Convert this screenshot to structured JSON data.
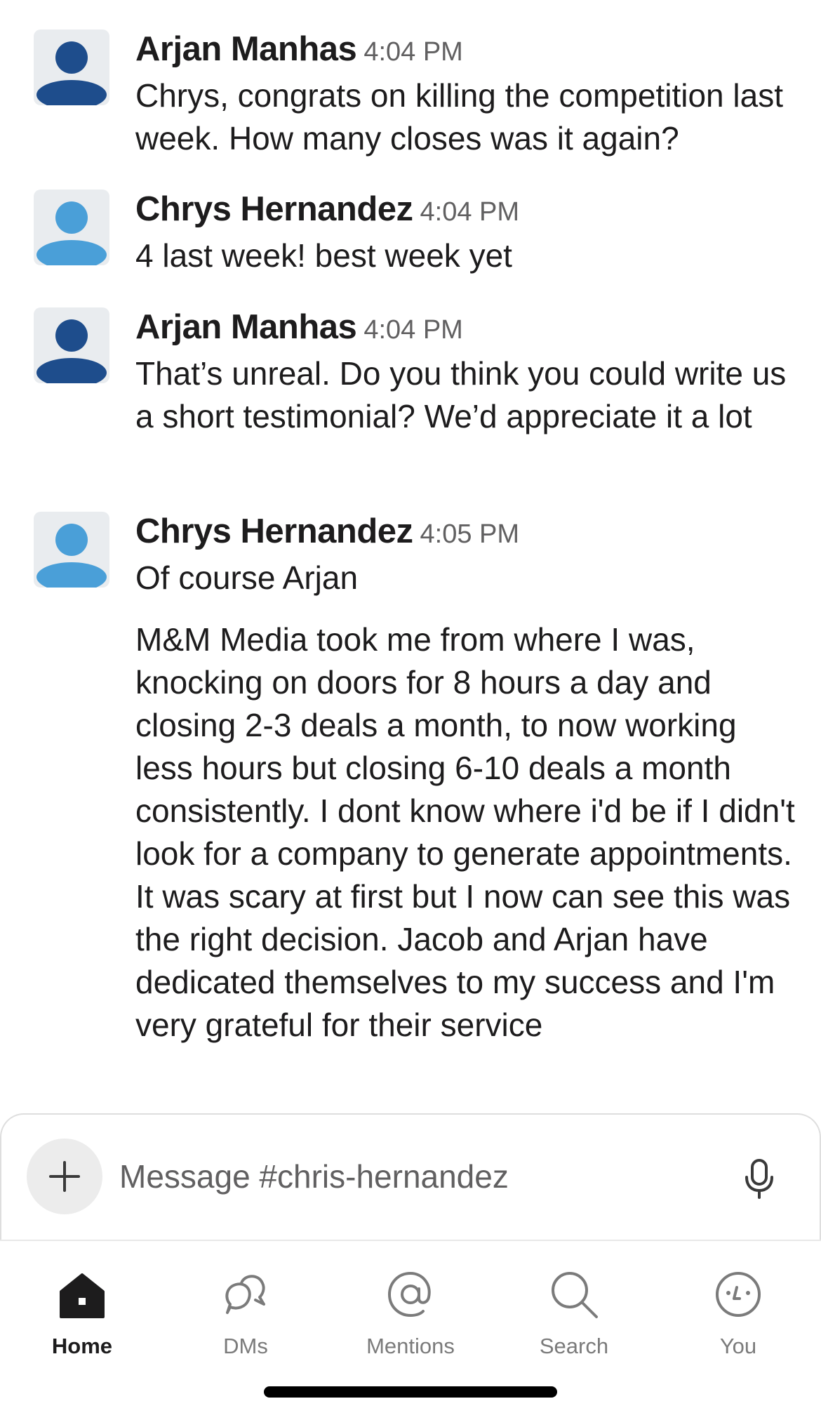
{
  "messages": [
    {
      "sender": "Arjan Manhas",
      "time": "4:04 PM",
      "avatar_color": "#1e4d8c",
      "paragraphs": [
        "Chrys, congrats on killing the competition last week. How many closes was it again?"
      ]
    },
    {
      "sender": "Chrys Hernandez",
      "time": "4:04 PM",
      "avatar_color": "#4a9fd8",
      "paragraphs": [
        "4 last week! best week yet"
      ]
    },
    {
      "sender": "Arjan Manhas",
      "time": "4:04 PM",
      "avatar_color": "#1e4d8c",
      "paragraphs": [
        "That’s unreal. Do you think you could write us a short testimonial? We’d appreciate it a lot"
      ]
    },
    {
      "sender": "Chrys Hernandez",
      "time": "4:05 PM",
      "avatar_color": "#4a9fd8",
      "paragraphs": [
        "Of course Arjan",
        "M&M Media took me from where I was, knocking on doors for 8 hours a day and closing 2-3 deals a month, to now working less hours but closing 6-10 deals a month consistently. I dont know where i'd be if I didn't look for a company to generate appointments. It was scary at first but I now can see this was the right decision. Jacob and Arjan have dedicated themselves to my success and I'm very grateful for their service"
      ]
    }
  ],
  "composer": {
    "placeholder": "Message #chris-hernandez",
    "value": "",
    "add_icon": "plus-icon",
    "mic_icon": "microphone-icon"
  },
  "tabs": [
    {
      "label": "Home",
      "icon": "home-icon",
      "active": true
    },
    {
      "label": "DMs",
      "icon": "dms-icon",
      "active": false
    },
    {
      "label": "Mentions",
      "icon": "at-icon",
      "active": false
    },
    {
      "label": "Search",
      "icon": "search-icon",
      "active": false
    },
    {
      "label": "You",
      "icon": "you-icon",
      "active": false
    }
  ]
}
